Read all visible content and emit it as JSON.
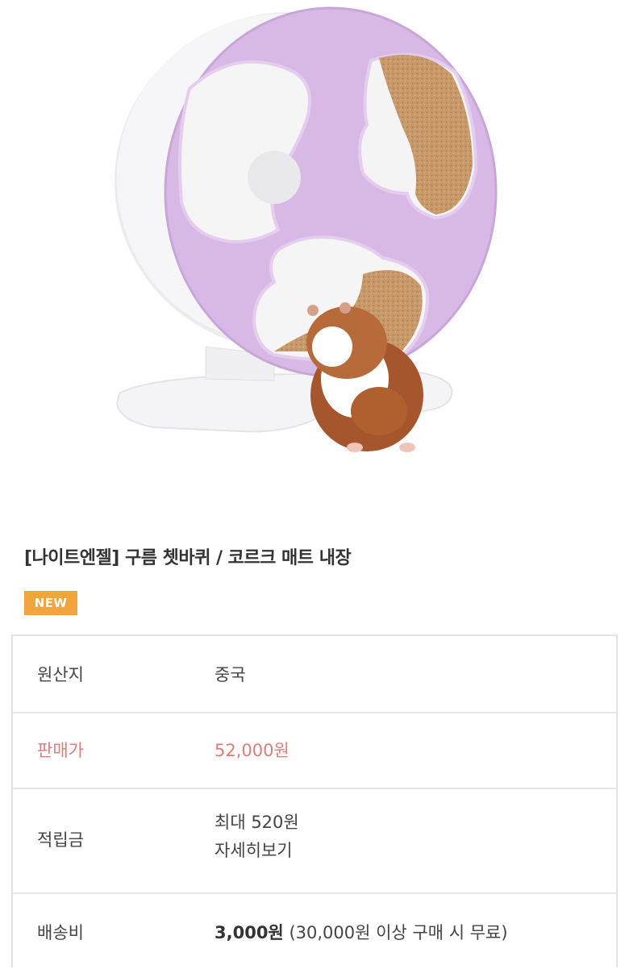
{
  "product": {
    "title": "[나이트엔젤] 구름 쳇바퀴 / 코르크 매트 내장",
    "badge": "NEW"
  },
  "info": {
    "origin": {
      "label": "원산지",
      "value": "중국"
    },
    "price": {
      "label": "판매가",
      "value": "52,000원"
    },
    "points": {
      "label": "적립금",
      "value": "최대 520원",
      "link": "자세히보기"
    },
    "shipping": {
      "label": "배송비",
      "value": "3,000원",
      "note": "(30,000원 이상 구매 시 무료)"
    }
  },
  "colors": {
    "price": "#d97e7e",
    "badge": "#f2a53c",
    "wheel": "#d9b8e6",
    "cork": "#c49766"
  }
}
